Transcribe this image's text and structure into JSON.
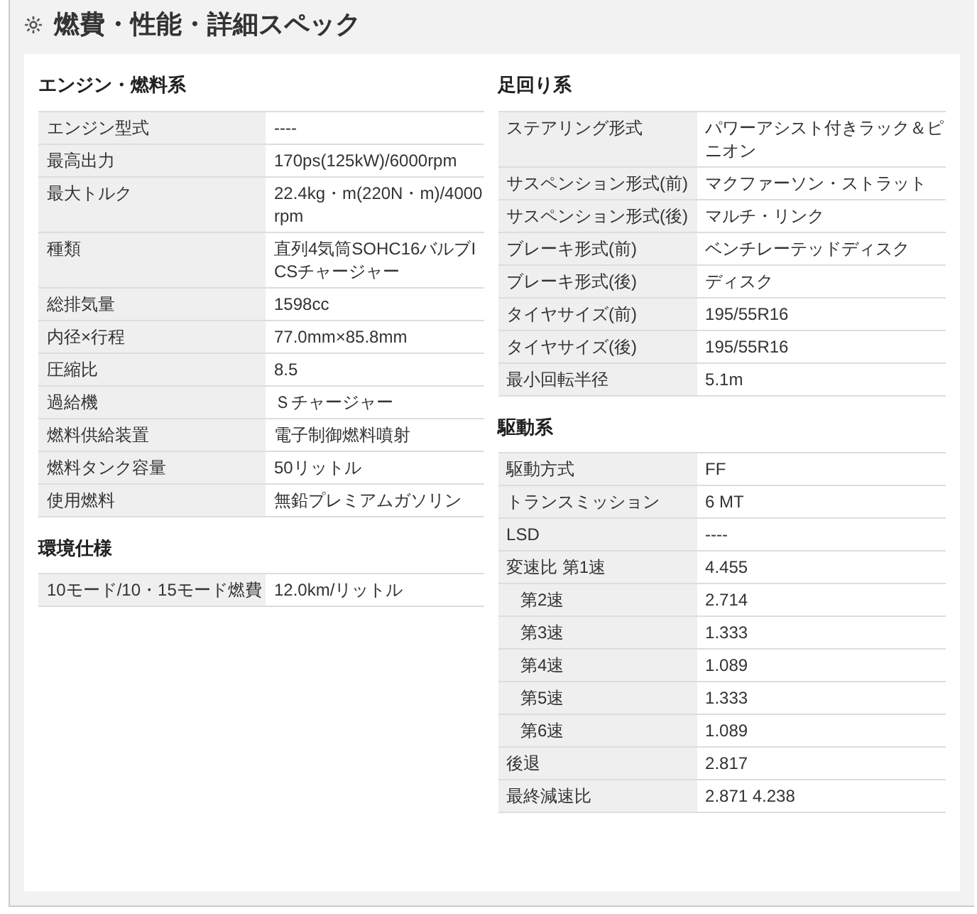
{
  "title": "燃費・性能・詳細スペック",
  "left": [
    {
      "heading": "エンジン・燃料系",
      "rows": [
        {
          "label": "エンジン型式",
          "value": "----"
        },
        {
          "label": "最高出力",
          "value": "170ps(125kW)/6000rpm"
        },
        {
          "label": "最大トルク",
          "value": "22.4kg・m(220N・m)/4000rpm"
        },
        {
          "label": "種類",
          "value": "直列4気筒SOHC16バルブICSチャージャー"
        },
        {
          "label": "総排気量",
          "value": "1598cc"
        },
        {
          "label": "内径×行程",
          "value": "77.0mm×85.8mm"
        },
        {
          "label": "圧縮比",
          "value": "8.5"
        },
        {
          "label": "過給機",
          "value": "Ｓチャージャー"
        },
        {
          "label": "燃料供給装置",
          "value": "電子制御燃料噴射"
        },
        {
          "label": "燃料タンク容量",
          "value": "50リットル"
        },
        {
          "label": "使用燃料",
          "value": "無鉛プレミアムガソリン"
        }
      ]
    },
    {
      "heading": "環境仕様",
      "rows": [
        {
          "label": "10モード/10・15モード燃費",
          "value": "12.0km/リットル"
        }
      ]
    }
  ],
  "right": [
    {
      "heading": "足回り系",
      "rows": [
        {
          "label": "ステアリング形式",
          "value": "パワーアシスト付きラック＆ピニオン"
        },
        {
          "label": "サスペンション形式(前)",
          "value": "マクファーソン・ストラット"
        },
        {
          "label": "サスペンション形式(後)",
          "value": "マルチ・リンク"
        },
        {
          "label": "ブレーキ形式(前)",
          "value": "ベンチレーテッドディスク"
        },
        {
          "label": "ブレーキ形式(後)",
          "value": "ディスク"
        },
        {
          "label": "タイヤサイズ(前)",
          "value": "195/55R16"
        },
        {
          "label": "タイヤサイズ(後)",
          "value": "195/55R16"
        },
        {
          "label": "最小回転半径",
          "value": "5.1m"
        }
      ]
    },
    {
      "heading": "駆動系",
      "rows": [
        {
          "label": "駆動方式",
          "value": "FF"
        },
        {
          "label": "トランスミッション",
          "value": "6 MT"
        },
        {
          "label": "LSD",
          "value": "----"
        },
        {
          "label": "変速比 第1速",
          "value": "4.455"
        },
        {
          "label": "第2速",
          "value": "2.714",
          "indent": true
        },
        {
          "label": "第3速",
          "value": "1.333",
          "indent": true
        },
        {
          "label": "第4速",
          "value": "1.089",
          "indent": true
        },
        {
          "label": "第5速",
          "value": "1.333",
          "indent": true
        },
        {
          "label": "第6速",
          "value": "1.089",
          "indent": true
        },
        {
          "label": "後退",
          "value": "2.817"
        },
        {
          "label": "最終減速比",
          "value": "2.871 4.238"
        }
      ]
    }
  ]
}
